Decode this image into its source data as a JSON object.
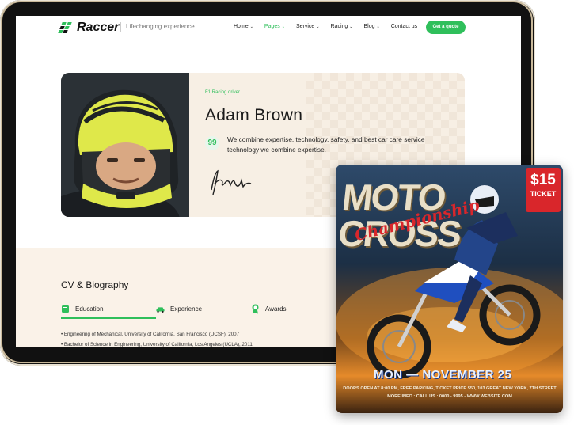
{
  "header": {
    "logo_text": "Raccer",
    "tagline": "Lifechanging experience",
    "nav": [
      {
        "label": "Home",
        "dropdown": true,
        "active": false
      },
      {
        "label": "Pages",
        "dropdown": true,
        "active": true
      },
      {
        "label": "Service",
        "dropdown": true,
        "active": false
      },
      {
        "label": "Racing",
        "dropdown": true,
        "active": false
      },
      {
        "label": "Blog",
        "dropdown": true,
        "active": false
      },
      {
        "label": "Contact us",
        "dropdown": false,
        "active": false
      }
    ],
    "cta_label": "Get a quote"
  },
  "profile": {
    "role": "F1 Racing driver",
    "name": "Adam Brown",
    "quote_icon": "99",
    "quote": "We combine expertise, technology, safety, and best car care service technology we combine expertise."
  },
  "cv": {
    "title": "CV & Biography",
    "tabs": [
      {
        "label": "Education",
        "icon": "book-icon",
        "active": true
      },
      {
        "label": "Experience",
        "icon": "car-icon",
        "active": false
      },
      {
        "label": "Awards",
        "icon": "award-icon",
        "active": false
      }
    ],
    "education": [
      "Engineering of Mechanical, University of California, San Francisco (UCSF), 2007",
      "Bachelor of Science in Engineering, University of California, Los Angeles (UCLA), 2011"
    ]
  },
  "flyer": {
    "title_line1": "MOTO",
    "title_line2": "CROSS",
    "script": "Championship",
    "ticket_price": "$15",
    "ticket_label": "TICKET",
    "date": "MON — NOVEMBER 25",
    "info_line1": "DOORS OPEN AT 8:00 PM, FREE PARKING, TICKET PRICE $50, 103 GREAT NEW YORK, 7TH STREET",
    "info_line2": "MORE INFO : CALL US : 0000 - 9995 - WWW.WEBSITE.COM"
  },
  "colors": {
    "accent": "#2fbf5b",
    "card_bg": "#f7efe4",
    "section_bg": "#faf2e8",
    "ticket": "#d9262b"
  }
}
